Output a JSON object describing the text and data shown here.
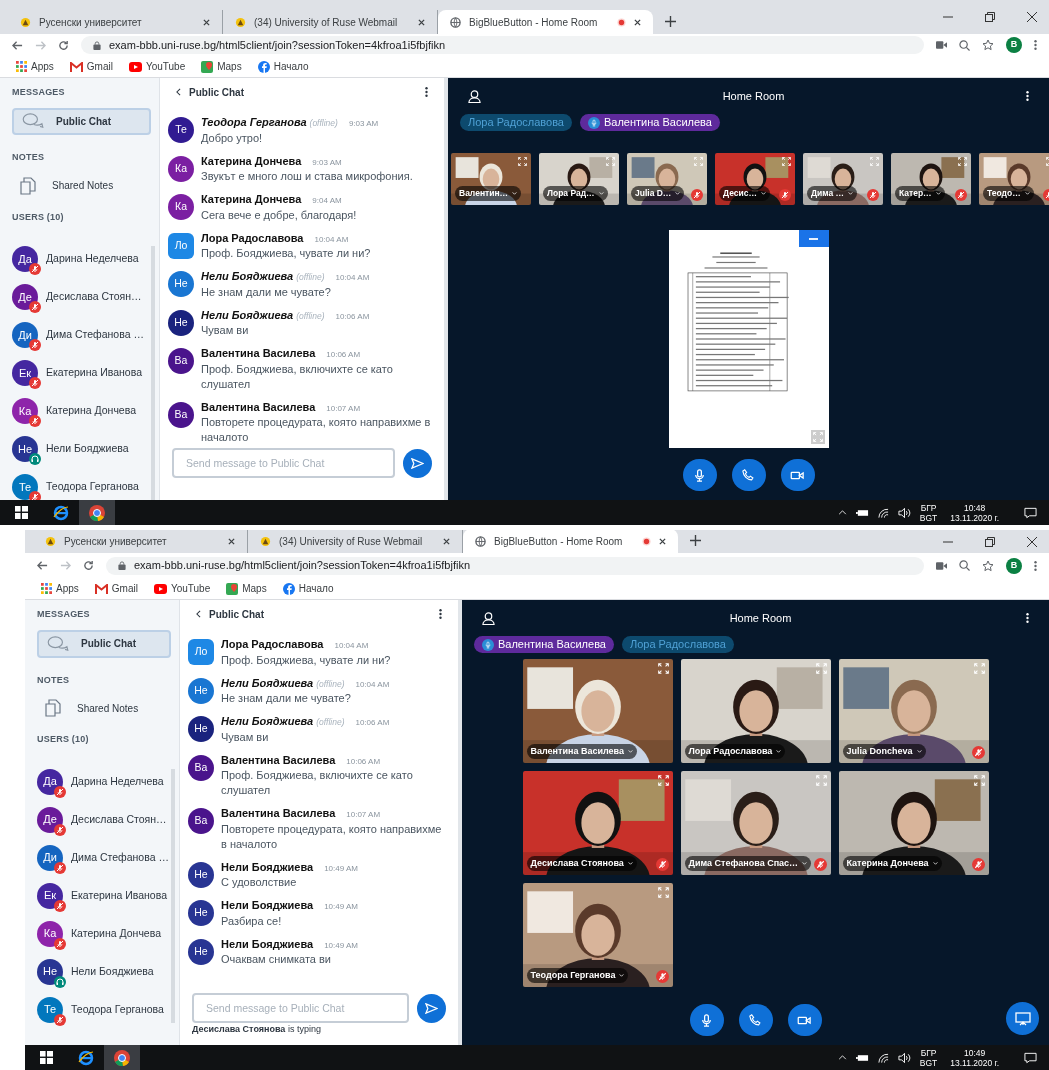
{
  "screens": [
    {
      "browser": {
        "tabs": [
          {
            "title": "Русенски университет",
            "selected": false,
            "recording": false
          },
          {
            "title": "(34) University of Ruse Webmail",
            "selected": false,
            "recording": false
          },
          {
            "title": "BigBlueButton - Home Room",
            "selected": true,
            "recording": true
          }
        ],
        "url": "exam-bbb.uni-ruse.bg/html5client/join?sessionToken=4kfroa1i5fbjfikn",
        "profile": "B",
        "bookmarks": [
          {
            "label": "Apps",
            "kind": "apps"
          },
          {
            "label": "Gmail",
            "kind": "gmail"
          },
          {
            "label": "YouTube",
            "kind": "youtube"
          },
          {
            "label": "Maps",
            "kind": "maps"
          },
          {
            "label": "Начало",
            "kind": "facebook"
          }
        ]
      },
      "sidebar": {
        "messages_heading": "MESSAGES",
        "public_chat": "Public Chat",
        "notes_heading": "NOTES",
        "shared_notes": "Shared Notes",
        "users_heading": "USERS (10)",
        "users": [
          {
            "initials": "Да",
            "name": "Дарина Неделчева",
            "color": "#4527a0",
            "kind": "muted"
          },
          {
            "initials": "Де",
            "name": "Десислава Стоян…",
            "color": "#6a1b9a",
            "kind": "muted"
          },
          {
            "initials": "Ди",
            "name": "Дима Стефанова …",
            "color": "#1565c0",
            "kind": "muted"
          },
          {
            "initials": "Ек",
            "name": "Екатерина Иванова",
            "color": "#4527a0",
            "kind": "muted"
          },
          {
            "initials": "Ка",
            "name": "Катерина Дончева",
            "color": "#8e24aa",
            "kind": "muted"
          },
          {
            "initials": "Не",
            "name": "Нели Бояджиева",
            "color": "#283593",
            "kind": "listener"
          },
          {
            "initials": "Те",
            "name": "Теодора Герганова",
            "color": "#0277bd",
            "kind": "muted"
          }
        ]
      },
      "chat": {
        "title": "Public Chat",
        "messages": [
          {
            "initials": "Те",
            "author": "Теодора Герганова",
            "note": "(offline)",
            "time": "9:03 AM",
            "text": "Добро утро!",
            "color": "#311b92",
            "moderator": false
          },
          {
            "initials": "Ка",
            "author": "Катерина Дончева",
            "time": "9:03 AM",
            "text": "Звукът е много лош и става микрофония.",
            "color": "#7b1fa2",
            "moderator": false
          },
          {
            "initials": "Ка",
            "author": "Катерина Дончева",
            "time": "9:04 AM",
            "text": "Сега вече е добре, благодаря!",
            "color": "#7b1fa2",
            "moderator": false
          },
          {
            "initials": "Ло",
            "author": "Лора Радославова",
            "time": "10:04 AM",
            "text": "Проф. Бояджиева, чувате ли ни?",
            "color": "#1e88e5",
            "moderator": true
          },
          {
            "initials": "Не",
            "author": "Нели Бояджиева",
            "note": "(offline)",
            "time": "10:04 AM",
            "text": "Не знам дали ме чувате?",
            "color": "#1976d2",
            "moderator": false
          },
          {
            "initials": "Не",
            "author": "Нели Бояджиева",
            "note": "(offline)",
            "time": "10:06 AM",
            "text": "Чувам ви",
            "color": "#1a237e",
            "moderator": false
          },
          {
            "initials": "Ва",
            "author": "Валентина Василева",
            "time": "10:06 AM",
            "text": "Проф. Бояджиева, включихте се като слушател",
            "color": "#4a148c",
            "moderator": false
          },
          {
            "initials": "Ва",
            "author": "Валентина Василева",
            "time": "10:07 AM",
            "text": "Повторете процедурата, която направихме в началото",
            "color": "#4a148c",
            "moderator": false
          }
        ],
        "placeholder": "Send message to Public Chat"
      },
      "room": {
        "title": "Home Room",
        "talkers": [
          {
            "name": "Лора Радославова",
            "talking": false
          },
          {
            "name": "Валентина Василева",
            "talking": true
          }
        ],
        "presentation": {
          "minimized": false
        },
        "videos": [
          {
            "name": "Валентин…",
            "muted": false
          },
          {
            "name": "Лора Рад…",
            "muted": false
          },
          {
            "name": "Julia D…",
            "muted": true
          },
          {
            "name": "Десис…",
            "muted": true
          },
          {
            "name": "Дима …",
            "muted": true
          },
          {
            "name": "Катер…",
            "muted": true
          },
          {
            "name": "Теодо…",
            "muted": true
          }
        ]
      },
      "taskbar": {
        "language": "БГР",
        "keyboard": "BGT",
        "time": "10:48",
        "date": "13.11.2020 г."
      }
    },
    {
      "browser": {
        "tabs": [
          {
            "title": "Русенски университет",
            "selected": false,
            "recording": false
          },
          {
            "title": "(34) University of Ruse Webmail",
            "selected": false,
            "recording": false
          },
          {
            "title": "BigBlueButton - Home Room",
            "selected": true,
            "recording": true
          }
        ],
        "url": "exam-bbb.uni-ruse.bg/html5client/join?sessionToken=4kfroa1i5fbjfikn",
        "profile": "B",
        "bookmarks": [
          {
            "label": "Apps",
            "kind": "apps"
          },
          {
            "label": "Gmail",
            "kind": "gmail"
          },
          {
            "label": "YouTube",
            "kind": "youtube"
          },
          {
            "label": "Maps",
            "kind": "maps"
          },
          {
            "label": "Начало",
            "kind": "facebook"
          }
        ]
      },
      "sidebar": {
        "messages_heading": "MESSAGES",
        "public_chat": "Public Chat",
        "notes_heading": "NOTES",
        "shared_notes": "Shared Notes",
        "users_heading": "USERS (10)",
        "users": [
          {
            "initials": "Да",
            "name": "Дарина Неделчева",
            "color": "#4527a0",
            "kind": "muted"
          },
          {
            "initials": "Де",
            "name": "Десислава Стоян…",
            "color": "#6a1b9a",
            "kind": "muted"
          },
          {
            "initials": "Ди",
            "name": "Дима Стефанова …",
            "color": "#1565c0",
            "kind": "muted"
          },
          {
            "initials": "Ек",
            "name": "Екатерина Иванова",
            "color": "#4527a0",
            "kind": "muted"
          },
          {
            "initials": "Ка",
            "name": "Катерина Дончева",
            "color": "#8e24aa",
            "kind": "muted"
          },
          {
            "initials": "Не",
            "name": "Нели Бояджиева",
            "color": "#283593",
            "kind": "listener"
          },
          {
            "initials": "Те",
            "name": "Теодора Герганова",
            "color": "#0277bd",
            "kind": "muted"
          }
        ]
      },
      "chat": {
        "title": "Public Chat",
        "messages": [
          {
            "initials": "Ло",
            "author": "Лора Радославова",
            "time": "10:04 AM",
            "text": "Проф. Бояджиева, чувате ли ни?",
            "color": "#1e88e5",
            "moderator": true
          },
          {
            "initials": "Не",
            "author": "Нели Бояджиева",
            "note": "(offline)",
            "time": "10:04 AM",
            "text": "Не знам дали ме чувате?",
            "color": "#1976d2",
            "moderator": false
          },
          {
            "initials": "Не",
            "author": "Нели Бояджиева",
            "note": "(offline)",
            "time": "10:06 AM",
            "text": "Чувам ви",
            "color": "#1a237e",
            "moderator": false
          },
          {
            "initials": "Ва",
            "author": "Валентина Василева",
            "time": "10:06 AM",
            "text": "Проф. Бояджиева, включихте се като слушател",
            "color": "#4a148c",
            "moderator": false
          },
          {
            "initials": "Ва",
            "author": "Валентина Василева",
            "time": "10:07 AM",
            "text": "Повторете процедурата, която направихме в началото",
            "color": "#4a148c",
            "moderator": false
          },
          {
            "initials": "Не",
            "author": "Нели Бояджиева",
            "time": "10:49 AM",
            "text": "С удоволствие",
            "color": "#283593",
            "moderator": false
          },
          {
            "initials": "Не",
            "author": "Нели Бояджиева",
            "time": "10:49 AM",
            "text": "Разбира се!",
            "color": "#283593",
            "moderator": false
          },
          {
            "initials": "Не",
            "author": "Нели Бояджиева",
            "time": "10:49 AM",
            "text": "Очаквам снимката ви",
            "color": "#283593",
            "moderator": false
          }
        ],
        "placeholder": "Send message to Public Chat",
        "typing": "**Десислава Стоянова** is typing"
      },
      "room": {
        "title": "Home Room",
        "talkers": [
          {
            "name": "Валентина Василева",
            "talking": true
          },
          {
            "name": "Лора Радославова",
            "talking": false
          }
        ],
        "presentation": {
          "minimized": true
        },
        "videos": [
          {
            "name": "Валентина Василева",
            "muted": false
          },
          {
            "name": "Лора Радославова",
            "muted": false
          },
          {
            "name": "Julia Doncheva",
            "muted": true
          },
          {
            "name": "Десислава Стоянова",
            "muted": true
          },
          {
            "name": "Дима Стефанова Спас…",
            "muted": true
          },
          {
            "name": "Катерина Дончева",
            "muted": true
          },
          {
            "name": "Теодора Герганова",
            "muted": true
          }
        ]
      },
      "taskbar": {
        "language": "БГР",
        "keyboard": "BGT",
        "time": "10:49",
        "date": "13.11.2020 г."
      }
    }
  ]
}
